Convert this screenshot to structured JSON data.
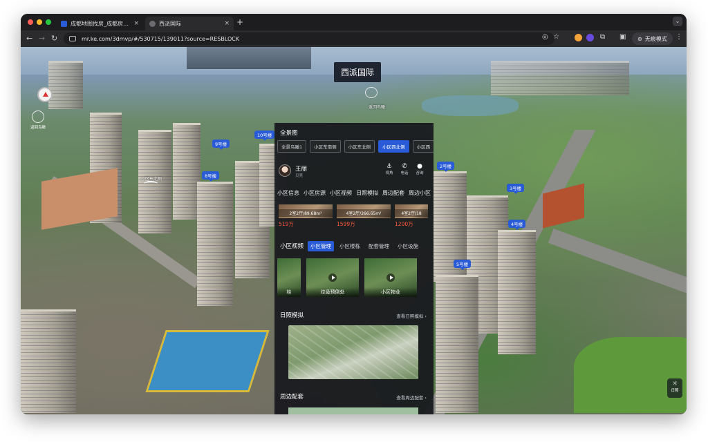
{
  "browser": {
    "tabs": [
      {
        "title": "成都地图找房_成都房价地图 |",
        "active": false
      },
      {
        "title": "西派国际",
        "active": true
      }
    ],
    "url": "mr.ke.com/3dmvp/#/530715/139011?source=RESBLOCK",
    "incognito_label": "无痕模式"
  },
  "map": {
    "project_title": "西派国际",
    "back_aerial_label": "返回鸟瞰",
    "back_aerial_label2": "返回鸟瞰",
    "building_labels": [
      "10号楼",
      "9号楼",
      "8号楼",
      "2号楼",
      "3号楼",
      "4号楼",
      "5号楼"
    ],
    "area_tags": [
      "小区东北侧"
    ],
    "daylight_button": "日照"
  },
  "panel": {
    "overview_title": "全景图",
    "view_chips": [
      {
        "label": "全景鸟瞰1",
        "active": false
      },
      {
        "label": "小区东南侧",
        "active": false
      },
      {
        "label": "小区东北侧",
        "active": false
      },
      {
        "label": "小区西北侧",
        "active": true
      },
      {
        "label": "小区西",
        "active": false
      }
    ],
    "agent": {
      "name": "王丽",
      "subtitle": "贝壳",
      "actions": [
        {
          "label": "视角",
          "icon": "anchor-icon"
        },
        {
          "label": "电话",
          "icon": "phone-icon"
        },
        {
          "label": "咨询",
          "icon": "chat-icon"
        }
      ]
    },
    "info_tabs": [
      "小区信息",
      "小区房源",
      "小区视频",
      "日照模拟",
      "周边配套",
      "周边小区"
    ],
    "listings": [
      {
        "spec": "2室2厅/89.68m²",
        "price": "519万"
      },
      {
        "spec": "4室2厅/266.65m²",
        "price": "1599万"
      },
      {
        "spec": "4室2厅/18",
        "price": "1200万"
      }
    ],
    "video_section": {
      "title": "小区视频",
      "tabs": [
        {
          "label": "小区管理",
          "active": true
        },
        {
          "label": "小区楼栋",
          "active": false
        },
        {
          "label": "配套管理",
          "active": false
        },
        {
          "label": "小区设施",
          "active": false
        }
      ],
      "videos": [
        {
          "caption": "栓"
        },
        {
          "caption": "垃圾预倒处"
        },
        {
          "caption": "小区物业"
        }
      ]
    },
    "sun_section": {
      "title": "日照模拟",
      "more": "查看日照模拟 ›"
    },
    "periphery_section": {
      "title": "周边配套",
      "more": "查看周边配套 ›"
    }
  }
}
